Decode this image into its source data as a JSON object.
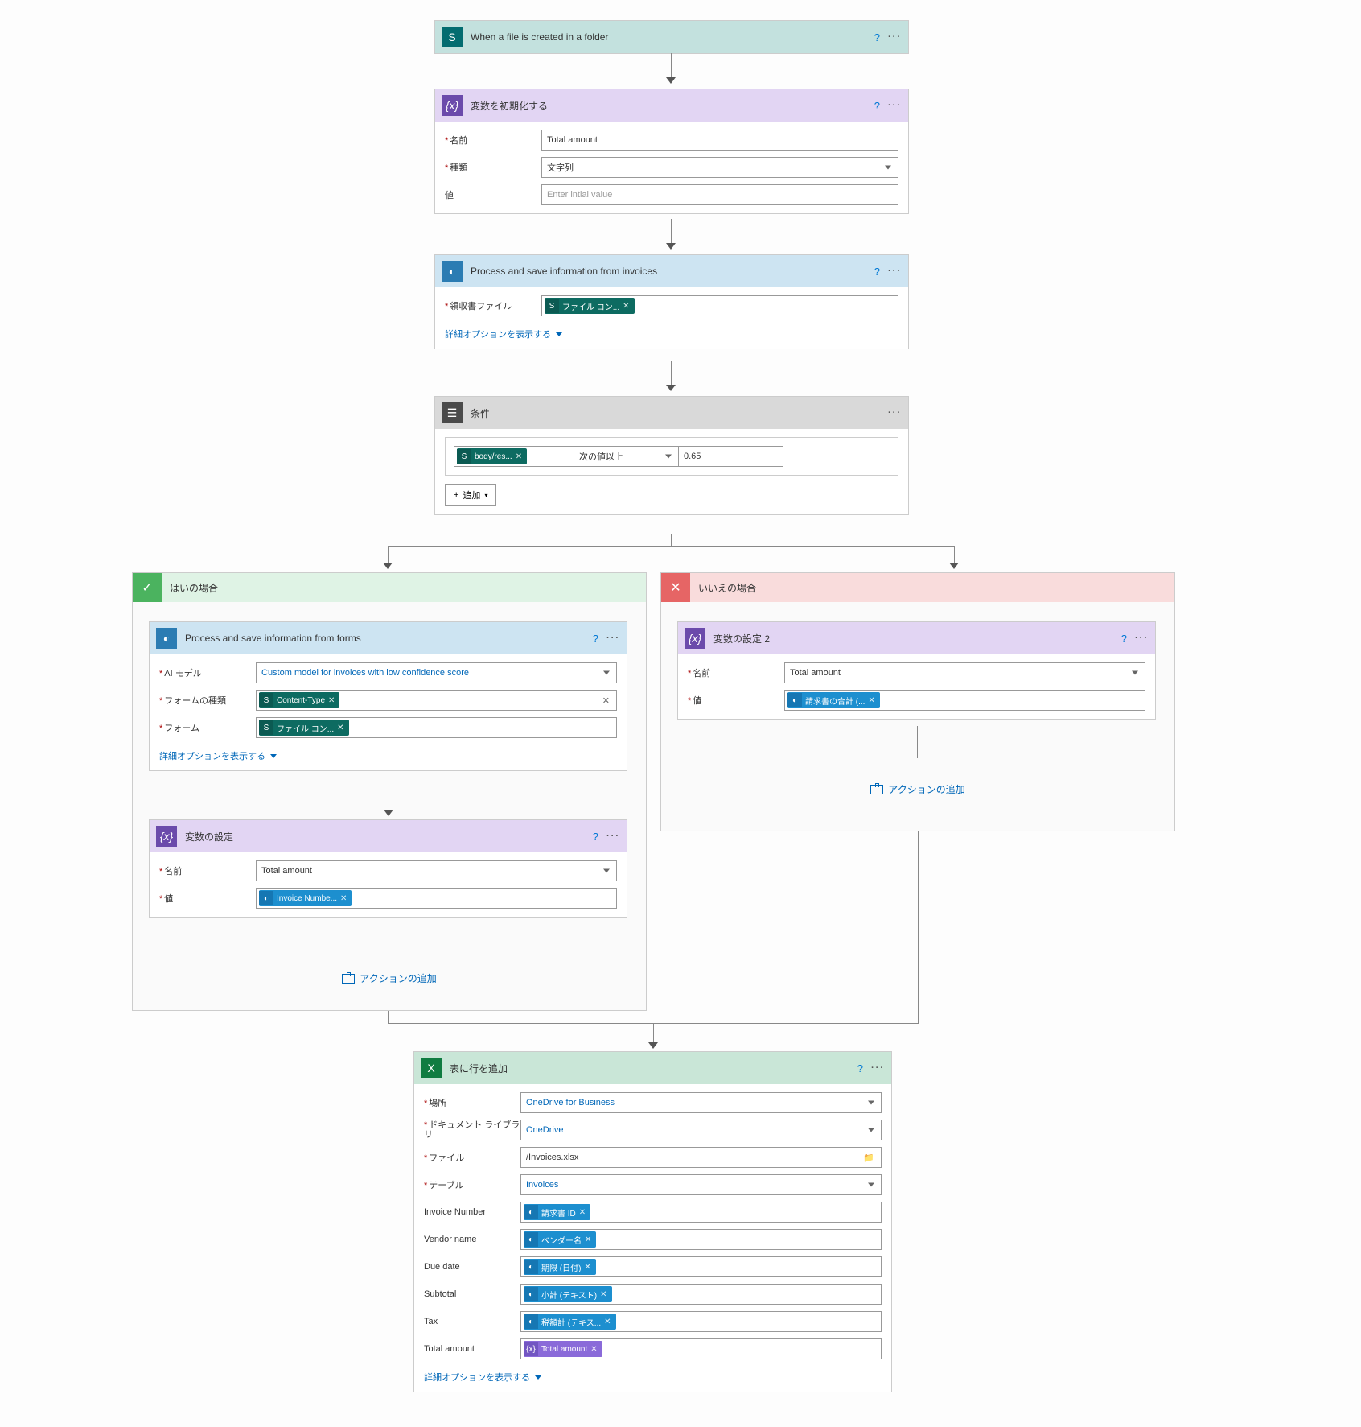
{
  "colors": {
    "sharepoint": "#036C70",
    "variable": "#6b4aab",
    "aibuilder": "#2b7cb3",
    "condition": "#4a4a4a",
    "excel": "#107C41",
    "yes": "#4bb35f",
    "no": "#e66565",
    "varHeader": "#e2d5f3",
    "aiHeader": "#cde4f2",
    "condHeader": "#d9d9d9",
    "excelHeader": "#c9e6d7",
    "spHeader": "#c3e1de",
    "yesHeader": "#dff3e5",
    "noHeader": "#f9dcdc"
  },
  "step1": {
    "title": "When a file is created in a folder"
  },
  "step2": {
    "title": "変数を初期化する",
    "nameLabel": "名前",
    "nameValue": "Total amount",
    "typeLabel": "種類",
    "typeValue": "文字列",
    "valueLabel": "値",
    "valuePlaceholder": "Enter intial value"
  },
  "step3": {
    "title": "Process and save information from invoices",
    "fileLabel": "領収書ファイル",
    "fileToken": "ファイル コン...",
    "advanced": "詳細オプションを表示する"
  },
  "cond": {
    "title": "条件",
    "token": "body/res...",
    "op": "次の値以上",
    "value": "0.65",
    "addBtn": "追加"
  },
  "yes": {
    "title": "はいの場合",
    "forms": {
      "title": "Process and save information from forms",
      "modelLabel": "AI モデル",
      "modelValue": "Custom model for invoices with low confidence score",
      "formTypeLabel": "フォームの種類",
      "formTypeToken": "Content-Type",
      "formLabel": "フォーム",
      "formToken": "ファイル コン...",
      "advanced": "詳細オプションを表示する"
    },
    "setvar": {
      "title": "変数の設定",
      "nameLabel": "名前",
      "nameValue": "Total amount",
      "valueLabel": "値",
      "valueToken": "Invoice Numbe..."
    },
    "addAction": "アクションの追加"
  },
  "no": {
    "title": "いいえの場合",
    "setvar2": {
      "title": "変数の設定 2",
      "nameLabel": "名前",
      "nameValue": "Total amount",
      "valueLabel": "値",
      "valueToken": "請求書の合計 (..."
    },
    "addAction": "アクションの追加"
  },
  "excel": {
    "title": "表に行を追加",
    "locLabel": "場所",
    "locValue": "OneDrive for Business",
    "libLabel": "ドキュメント ライブラリ",
    "libValue": "OneDrive",
    "fileLabel": "ファイル",
    "fileValue": "/Invoices.xlsx",
    "tableLabel": "テーブル",
    "tableValue": "Invoices",
    "rows": [
      {
        "label": "Invoice Number",
        "token": "請求書 ID",
        "type": "blue"
      },
      {
        "label": "Vendor name",
        "token": "ベンダー名",
        "type": "blue"
      },
      {
        "label": "Due date",
        "token": "期限 (日付)",
        "type": "blue"
      },
      {
        "label": "Subtotal",
        "token": "小計 (テキスト)",
        "type": "blue"
      },
      {
        "label": "Tax",
        "token": "税額計 (テキス...",
        "type": "blue"
      },
      {
        "label": "Total amount",
        "token": "Total amount",
        "type": "purple"
      }
    ],
    "advanced": "詳細オプションを表示する"
  }
}
